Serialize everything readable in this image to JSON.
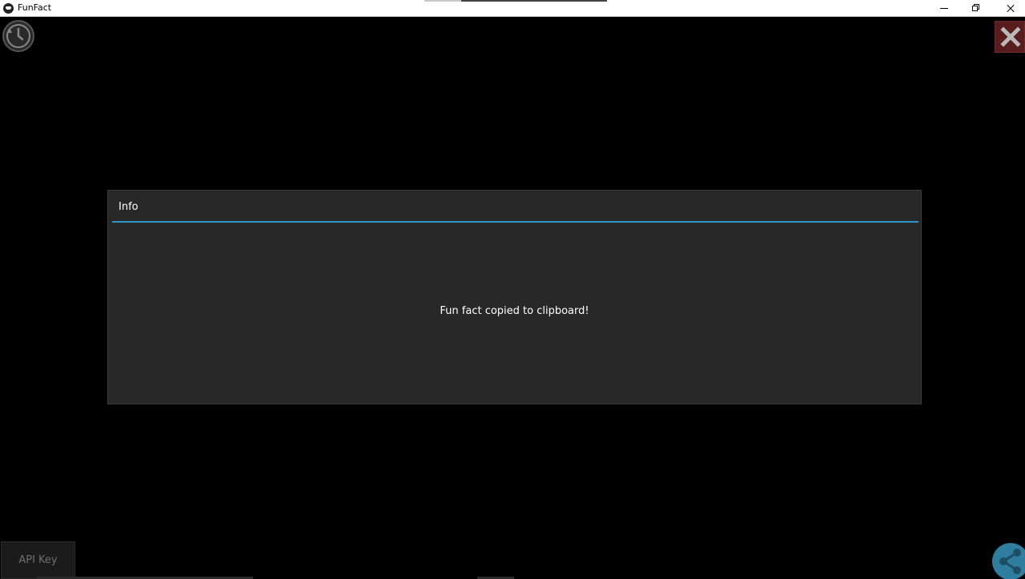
{
  "window": {
    "title": "FunFact",
    "icon": "app-icon"
  },
  "toolbar": {
    "history_icon": "history-icon",
    "close_icon": "close-icon",
    "share_icon": "share-icon",
    "api_key_label": "API Key"
  },
  "dialog": {
    "title": "Info",
    "message": "Fun fact copied to clipboard!"
  },
  "colors": {
    "accent": "#2d98c9",
    "dialog_bg": "#282828",
    "close_bg": "#5a1d1d",
    "share_bg": "#2f7ea0"
  }
}
